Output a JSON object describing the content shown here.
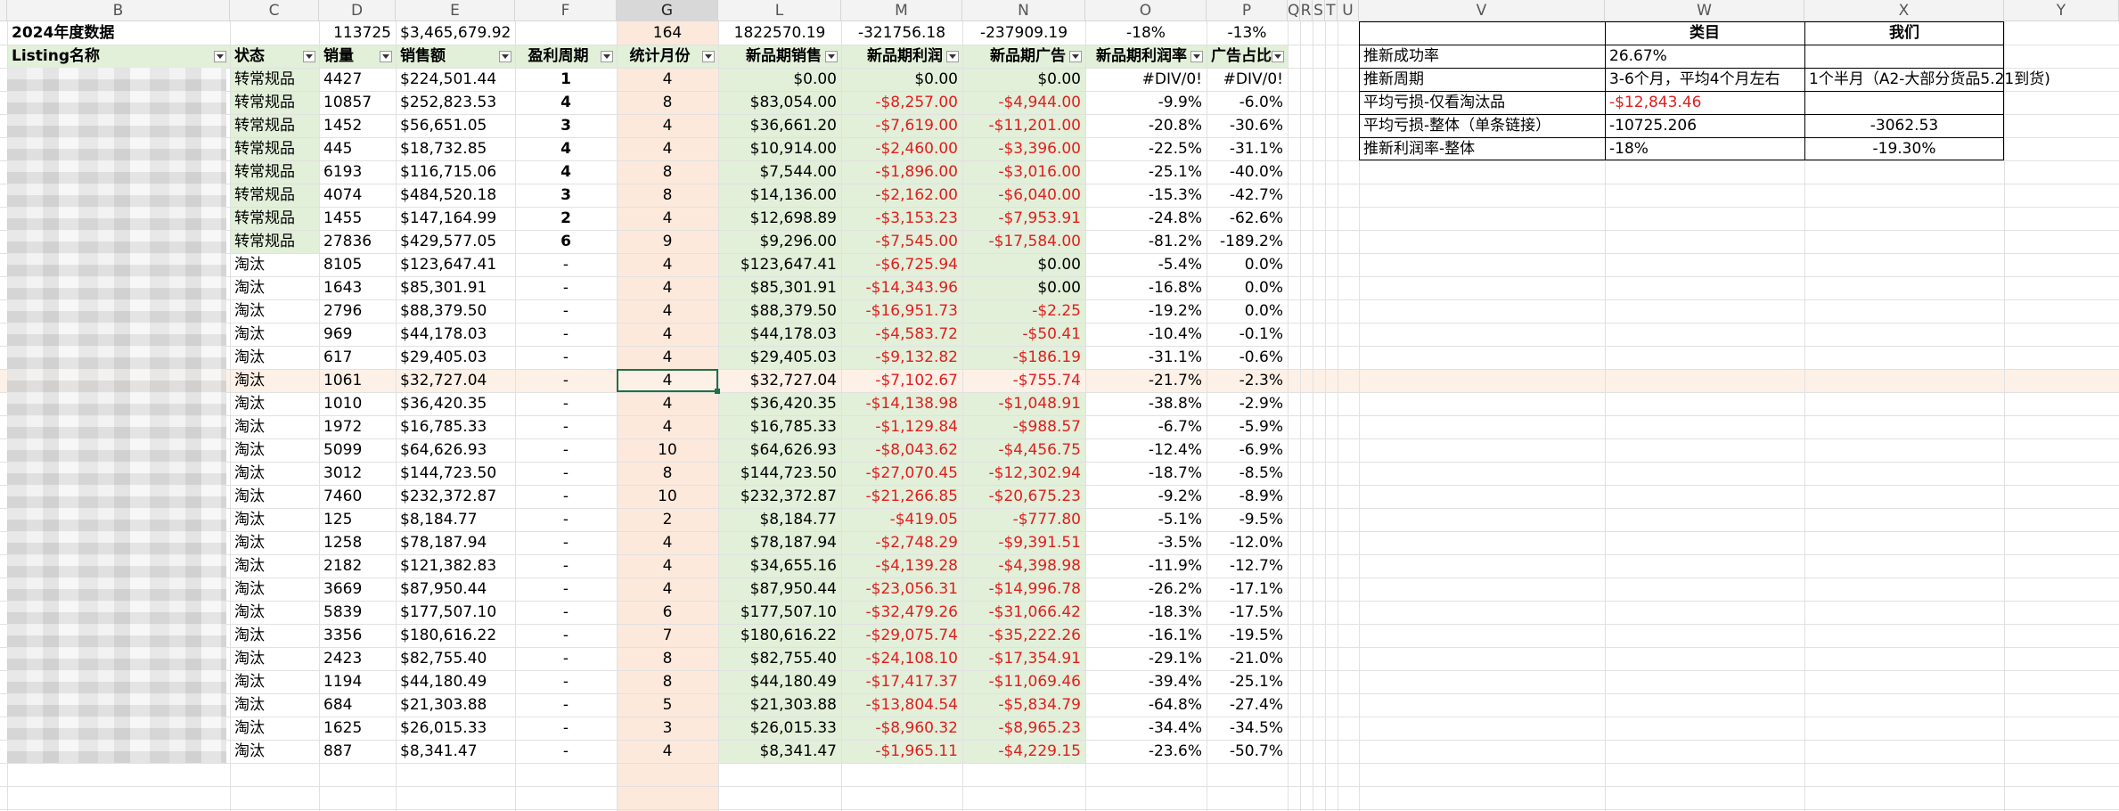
{
  "colors": {
    "header_green": "#e2efd9",
    "status_green": "#e2efd9",
    "orange_col": "#fce9dc",
    "selected_row": "#fdf0e6",
    "negative_red": "#e01e1e"
  },
  "col_headers": {
    "B": "B",
    "C": "C",
    "D": "D",
    "E": "E",
    "F": "F",
    "G": "G",
    "L": "L",
    "M": "M",
    "N": "N",
    "O": "O",
    "P": "P",
    "Q": "Q",
    "R": "R",
    "S": "S",
    "T": "T",
    "U": "U",
    "V": "V",
    "W": "W",
    "X": "X",
    "Y": "Y"
  },
  "summary_row": {
    "label": "2024年度数据",
    "sales_qty": "113725",
    "sales_amount": "$3,465,679.92",
    "period_total": "164",
    "new_sales_total": "1822570.19",
    "new_profit_total": "-321756.18",
    "new_ad_total": "-237909.19",
    "profit_rate": "-18%",
    "ad_rate": "-13%"
  },
  "table_headers": {
    "listing": "Listing名称",
    "status": "状态",
    "qty": "销量",
    "amount": "销售额",
    "cycle": "盈利周期",
    "months": "统计月份",
    "new_sales": "新品期销售",
    "new_profit": "新品期利润",
    "new_ad": "新品期广告",
    "new_profit_rate": "新品期利润率",
    "ad_ratio": "广告占比"
  },
  "rows": [
    {
      "status": "转常规品",
      "qty": "4427",
      "amount": "$224,501.44",
      "cycle": "1",
      "months": "4",
      "sales": "$0.00",
      "profit": "$0.00",
      "ad": "$0.00",
      "rate": "#DIV/0!",
      "adr": "#DIV/0!"
    },
    {
      "status": "转常规品",
      "qty": "10857",
      "amount": "$252,823.53",
      "cycle": "4",
      "months": "8",
      "sales": "$83,054.00",
      "profit": "-$8,257.00",
      "ad": "-$4,944.00",
      "rate": "-9.9%",
      "adr": "-6.0%"
    },
    {
      "status": "转常规品",
      "qty": "1452",
      "amount": "$56,651.05",
      "cycle": "3",
      "months": "4",
      "sales": "$36,661.20",
      "profit": "-$7,619.00",
      "ad": "-$11,201.00",
      "rate": "-20.8%",
      "adr": "-30.6%"
    },
    {
      "status": "转常规品",
      "qty": "445",
      "amount": "$18,732.85",
      "cycle": "4",
      "months": "4",
      "sales": "$10,914.00",
      "profit": "-$2,460.00",
      "ad": "-$3,396.00",
      "rate": "-22.5%",
      "adr": "-31.1%"
    },
    {
      "status": "转常规品",
      "qty": "6193",
      "amount": "$116,715.06",
      "cycle": "4",
      "months": "8",
      "sales": "$7,544.00",
      "profit": "-$1,896.00",
      "ad": "-$3,016.00",
      "rate": "-25.1%",
      "adr": "-40.0%"
    },
    {
      "status": "转常规品",
      "qty": "4074",
      "amount": "$484,520.18",
      "cycle": "3",
      "months": "8",
      "sales": "$14,136.00",
      "profit": "-$2,162.00",
      "ad": "-$6,040.00",
      "rate": "-15.3%",
      "adr": "-42.7%"
    },
    {
      "status": "转常规品",
      "qty": "1455",
      "amount": "$147,164.99",
      "cycle": "2",
      "months": "4",
      "sales": "$12,698.89",
      "profit": "-$3,153.23",
      "ad": "-$7,953.91",
      "rate": "-24.8%",
      "adr": "-62.6%"
    },
    {
      "status": "转常规品",
      "qty": "27836",
      "amount": "$429,577.05",
      "cycle": "6",
      "months": "9",
      "sales": "$9,296.00",
      "profit": "-$7,545.00",
      "ad": "-$17,584.00",
      "rate": "-81.2%",
      "adr": "-189.2%"
    },
    {
      "status": "淘汰",
      "qty": "8105",
      "amount": "$123,647.41",
      "cycle": "-",
      "months": "4",
      "sales": "$123,647.41",
      "profit": "-$6,725.94",
      "ad": "$0.00",
      "rate": "-5.4%",
      "adr": "0.0%"
    },
    {
      "status": "淘汰",
      "qty": "1643",
      "amount": "$85,301.91",
      "cycle": "-",
      "months": "4",
      "sales": "$85,301.91",
      "profit": "-$14,343.96",
      "ad": "$0.00",
      "rate": "-16.8%",
      "adr": "0.0%"
    },
    {
      "status": "淘汰",
      "qty": "2796",
      "amount": "$88,379.50",
      "cycle": "-",
      "months": "4",
      "sales": "$88,379.50",
      "profit": "-$16,951.73",
      "ad": "-$2.25",
      "rate": "-19.2%",
      "adr": "0.0%"
    },
    {
      "status": "淘汰",
      "qty": "969",
      "amount": "$44,178.03",
      "cycle": "-",
      "months": "4",
      "sales": "$44,178.03",
      "profit": "-$4,583.72",
      "ad": "-$50.41",
      "rate": "-10.4%",
      "adr": "-0.1%"
    },
    {
      "status": "淘汰",
      "qty": "617",
      "amount": "$29,405.03",
      "cycle": "-",
      "months": "4",
      "sales": "$29,405.03",
      "profit": "-$9,132.82",
      "ad": "-$186.19",
      "rate": "-31.1%",
      "adr": "-0.6%"
    },
    {
      "status": "淘汰",
      "qty": "1061",
      "amount": "$32,727.04",
      "cycle": "-",
      "months": "4",
      "sales": "$32,727.04",
      "profit": "-$7,102.67",
      "ad": "-$755.74",
      "rate": "-21.7%",
      "adr": "-2.3%"
    },
    {
      "status": "淘汰",
      "qty": "1010",
      "amount": "$36,420.35",
      "cycle": "-",
      "months": "4",
      "sales": "$36,420.35",
      "profit": "-$14,138.98",
      "ad": "-$1,048.91",
      "rate": "-38.8%",
      "adr": "-2.9%"
    },
    {
      "status": "淘汰",
      "qty": "1972",
      "amount": "$16,785.33",
      "cycle": "-",
      "months": "4",
      "sales": "$16,785.33",
      "profit": "-$1,129.84",
      "ad": "-$988.57",
      "rate": "-6.7%",
      "adr": "-5.9%"
    },
    {
      "status": "淘汰",
      "qty": "5099",
      "amount": "$64,626.93",
      "cycle": "-",
      "months": "10",
      "sales": "$64,626.93",
      "profit": "-$8,043.62",
      "ad": "-$4,456.75",
      "rate": "-12.4%",
      "adr": "-6.9%"
    },
    {
      "status": "淘汰",
      "qty": "3012",
      "amount": "$144,723.50",
      "cycle": "-",
      "months": "8",
      "sales": "$144,723.50",
      "profit": "-$27,070.45",
      "ad": "-$12,302.94",
      "rate": "-18.7%",
      "adr": "-8.5%"
    },
    {
      "status": "淘汰",
      "qty": "7460",
      "amount": "$232,372.87",
      "cycle": "-",
      "months": "10",
      "sales": "$232,372.87",
      "profit": "-$21,266.85",
      "ad": "-$20,675.23",
      "rate": "-9.2%",
      "adr": "-8.9%"
    },
    {
      "status": "淘汰",
      "qty": "125",
      "amount": "$8,184.77",
      "cycle": "-",
      "months": "2",
      "sales": "$8,184.77",
      "profit": "-$419.05",
      "ad": "-$777.80",
      "rate": "-5.1%",
      "adr": "-9.5%"
    },
    {
      "status": "淘汰",
      "qty": "1258",
      "amount": "$78,187.94",
      "cycle": "-",
      "months": "4",
      "sales": "$78,187.94",
      "profit": "-$2,748.29",
      "ad": "-$9,391.51",
      "rate": "-3.5%",
      "adr": "-12.0%"
    },
    {
      "status": "淘汰",
      "qty": "2182",
      "amount": "$121,382.83",
      "cycle": "-",
      "months": "4",
      "sales": "$34,655.16",
      "profit": "-$4,139.28",
      "ad": "-$4,398.98",
      "rate": "-11.9%",
      "adr": "-12.7%"
    },
    {
      "status": "淘汰",
      "qty": "3669",
      "amount": "$87,950.44",
      "cycle": "-",
      "months": "4",
      "sales": "$87,950.44",
      "profit": "-$23,056.31",
      "ad": "-$14,996.78",
      "rate": "-26.2%",
      "adr": "-17.1%"
    },
    {
      "status": "淘汰",
      "qty": "5839",
      "amount": "$177,507.10",
      "cycle": "-",
      "months": "6",
      "sales": "$177,507.10",
      "profit": "-$32,479.26",
      "ad": "-$31,066.42",
      "rate": "-18.3%",
      "adr": "-17.5%"
    },
    {
      "status": "淘汰",
      "qty": "3356",
      "amount": "$180,616.22",
      "cycle": "-",
      "months": "7",
      "sales": "$180,616.22",
      "profit": "-$29,075.74",
      "ad": "-$35,222.26",
      "rate": "-16.1%",
      "adr": "-19.5%"
    },
    {
      "status": "淘汰",
      "qty": "2423",
      "amount": "$82,755.40",
      "cycle": "-",
      "months": "8",
      "sales": "$82,755.40",
      "profit": "-$24,108.10",
      "ad": "-$17,354.91",
      "rate": "-29.1%",
      "adr": "-21.0%"
    },
    {
      "status": "淘汰",
      "qty": "1194",
      "amount": "$44,180.49",
      "cycle": "-",
      "months": "8",
      "sales": "$44,180.49",
      "profit": "-$17,417.37",
      "ad": "-$11,069.46",
      "rate": "-39.4%",
      "adr": "-25.1%"
    },
    {
      "status": "淘汰",
      "qty": "684",
      "amount": "$21,303.88",
      "cycle": "-",
      "months": "5",
      "sales": "$21,303.88",
      "profit": "-$13,804.54",
      "ad": "-$5,834.79",
      "rate": "-64.8%",
      "adr": "-27.4%"
    },
    {
      "status": "淘汰",
      "qty": "1625",
      "amount": "$26,015.33",
      "cycle": "-",
      "months": "3",
      "sales": "$26,015.33",
      "profit": "-$8,960.32",
      "ad": "-$8,965.23",
      "rate": "-34.4%",
      "adr": "-34.5%"
    },
    {
      "status": "淘汰",
      "qty": "887",
      "amount": "$8,341.47",
      "cycle": "-",
      "months": "4",
      "sales": "$8,341.47",
      "profit": "-$1,965.11",
      "ad": "-$4,229.15",
      "rate": "-23.6%",
      "adr": "-50.7%"
    }
  ],
  "side_table": {
    "head_category": "类目",
    "head_us": "我们",
    "rows": [
      {
        "label": "推新成功率",
        "cat": "26.67%",
        "us": ""
      },
      {
        "label": "推新周期",
        "cat": "3-6个月，平均4个月左右",
        "us": "1个半月（A2-大部分货品5.21到货)"
      },
      {
        "label": "平均亏损-仅看淘汰品",
        "cat": "-$12,843.46",
        "us": ""
      },
      {
        "label": "平均亏损-整体（单条链接）",
        "cat": "-10725.206",
        "us": "-3062.53"
      },
      {
        "label": "推新利润率-整体",
        "cat": "-18%",
        "us": "-19.30%"
      }
    ]
  }
}
